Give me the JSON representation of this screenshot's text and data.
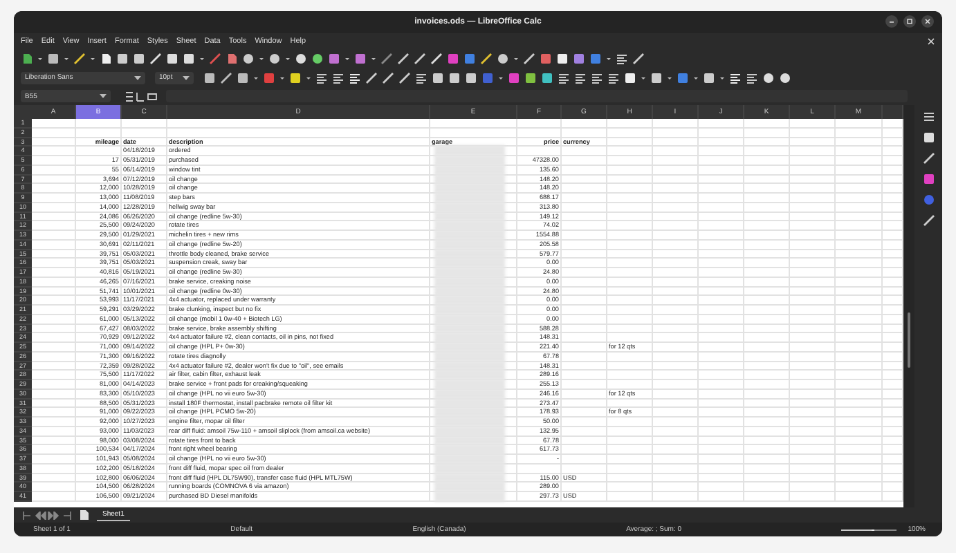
{
  "window": {
    "title": "invoices.ods — LibreOffice Calc"
  },
  "menu": [
    "File",
    "Edit",
    "View",
    "Insert",
    "Format",
    "Styles",
    "Sheet",
    "Data",
    "Tools",
    "Window",
    "Help"
  ],
  "toolbar": {
    "font_name": "Liberation Sans",
    "font_size": "10pt"
  },
  "formula_bar": {
    "name_box": "B55"
  },
  "columns": [
    {
      "label": "A",
      "selected": false
    },
    {
      "label": "B",
      "selected": true
    },
    {
      "label": "C",
      "selected": false
    },
    {
      "label": "D",
      "selected": false
    },
    {
      "label": "E",
      "selected": false
    },
    {
      "label": "F",
      "selected": false
    },
    {
      "label": "G",
      "selected": false
    },
    {
      "label": "H",
      "selected": false
    },
    {
      "label": "I",
      "selected": false
    },
    {
      "label": "J",
      "selected": false
    },
    {
      "label": "K",
      "selected": false
    },
    {
      "label": "L",
      "selected": false
    },
    {
      "label": "M",
      "selected": false
    }
  ],
  "rows": [
    {
      "number": "1"
    },
    {
      "number": "2"
    },
    {
      "number": "3",
      "kind": "header",
      "mileage": "mileage",
      "date": "date",
      "description": "description",
      "garage": "garage",
      "price": "price",
      "currency": "currency"
    },
    {
      "number": "4",
      "redacted": true,
      "date": "04/18/2019",
      "description": "ordered"
    },
    {
      "number": "5",
      "redacted": true,
      "mileage": "17",
      "date": "05/31/2019",
      "description": "purchased",
      "price": "47328.00"
    },
    {
      "number": "6",
      "redacted": true,
      "mileage": "55",
      "date": "06/14/2019",
      "description": "window tint",
      "price": "135.60"
    },
    {
      "number": "7",
      "redacted": true,
      "mileage": "3,694",
      "date": "07/12/2019",
      "description": "oil change",
      "price": "148.20"
    },
    {
      "number": "8",
      "redacted": true,
      "mileage": "12,000",
      "date": "10/28/2019",
      "description": "oil change",
      "price": "148.20"
    },
    {
      "number": "9",
      "redacted": true,
      "mileage": "13,000",
      "date": "11/08/2019",
      "description": "step bars",
      "price": "688.17"
    },
    {
      "number": "10",
      "redacted": true,
      "mileage": "14,000",
      "date": "12/28/2019",
      "description": "hellwig sway bar",
      "price": "313.80"
    },
    {
      "number": "11",
      "redacted": true,
      "mileage": "24,086",
      "date": "06/26/2020",
      "description": "oil change (redline 5w-30)",
      "price": "149.12"
    },
    {
      "number": "12",
      "redacted": true,
      "mileage": "25,500",
      "date": "09/24/2020",
      "description": "rotate tires",
      "price": "74.02"
    },
    {
      "number": "13",
      "redacted": true,
      "mileage": "29,500",
      "date": "01/29/2021",
      "description": "michelin tires + new rims",
      "price": "1554.88"
    },
    {
      "number": "14",
      "redacted": true,
      "mileage": "30,691",
      "date": "02/11/2021",
      "description": "oil change (redline 5w-20)",
      "price": "205.58"
    },
    {
      "number": "15",
      "redacted": true,
      "mileage": "39,751",
      "date": "05/03/2021",
      "description": "throttle body cleaned, brake service",
      "price": "579.77"
    },
    {
      "number": "16",
      "redacted": true,
      "mileage": "39,751",
      "date": "05/03/2021",
      "description": "suspension creak, sway bar",
      "price": "0.00"
    },
    {
      "number": "17",
      "redacted": true,
      "mileage": "40,816",
      "date": "05/19/2021",
      "description": "oil change (redline 5w-30)",
      "price": "24.80"
    },
    {
      "number": "18",
      "redacted": true,
      "mileage": "46,265",
      "date": "07/16/2021",
      "description": "brake service, creaking noise",
      "price": "0.00"
    },
    {
      "number": "19",
      "redacted": true,
      "mileage": "51,741",
      "date": "10/01/2021",
      "description": "oil change (redline 0w-30)",
      "price": "24.80"
    },
    {
      "number": "20",
      "redacted": true,
      "mileage": "53,993",
      "date": "11/17/2021",
      "description": "4x4 actuator, replaced under warranty",
      "price": "0.00"
    },
    {
      "number": "21",
      "redacted": true,
      "mileage": "59,291",
      "date": "03/29/2022",
      "description": "brake clunking, inspect but no fix",
      "price": "0.00"
    },
    {
      "number": "22",
      "redacted": true,
      "mileage": "61,000",
      "date": "05/13/2022",
      "description": "oil change (mobil 1 0w-40 + Biotech LG)",
      "price": "0.00"
    },
    {
      "number": "23",
      "redacted": true,
      "mileage": "67,427",
      "date": "08/03/2022",
      "description": "brake service, brake assembly shifting",
      "price": "588.28"
    },
    {
      "number": "24",
      "redacted": true,
      "mileage": "70,929",
      "date": "09/12/2022",
      "description": "4x4 actuator failure #2, clean contacts, oil in pins, not fixed",
      "price": "148.31"
    },
    {
      "number": "25",
      "redacted": true,
      "mileage": "71,000",
      "date": "09/14/2022",
      "description": "oil change (HPL P+ 0w-30)",
      "price": "221.40",
      "note": "for 12 qts"
    },
    {
      "number": "26",
      "redacted": true,
      "mileage": "71,300",
      "date": "09/16/2022",
      "description": "rotate tires diagnolly",
      "price": "67.78"
    },
    {
      "number": "27",
      "redacted": true,
      "mileage": "72,359",
      "date": "09/28/2022",
      "description": "4x4 actuator failure #2, dealer won't fix due to \"oil\", see emails",
      "price": "148.31"
    },
    {
      "number": "28",
      "redacted": true,
      "mileage": "75,500",
      "date": "11/17/2022",
      "description": "air filter, cabin filter, exhaust leak",
      "price": "289.16"
    },
    {
      "number": "29",
      "redacted": true,
      "mileage": "81,000",
      "date": "04/14/2023",
      "description": "brake service + front pads for creaking/squeaking",
      "price": "255.13"
    },
    {
      "number": "30",
      "redacted": true,
      "mileage": "83,300",
      "date": "05/10/2023",
      "description": "oil change (HPL no vii euro 5w-30)",
      "price": "246.16",
      "note": "for 12 qts"
    },
    {
      "number": "31",
      "redacted": true,
      "mileage": "88,500",
      "date": "05/31/2023",
      "description": "install 180F thermostat, install pacbrake remote oil filter kit",
      "price": "273.47"
    },
    {
      "number": "32",
      "redacted": true,
      "mileage": "91,000",
      "date": "09/22/2023",
      "description": "oil change (HPL PCMO 5w-20)",
      "price": "178.93",
      "note": "for 8 qts"
    },
    {
      "number": "33",
      "redacted": true,
      "mileage": "92,000",
      "date": "10/27/2023",
      "description": "engine filter, mopar oil filter",
      "price": "50.00"
    },
    {
      "number": "34",
      "redacted": true,
      "mileage": "93,000",
      "date": "11/03/2023",
      "description": "rear diff fluid: amsoil 75w-110 + amsoil sliplock (from amsoil.ca website)",
      "price": "132.95"
    },
    {
      "number": "35",
      "redacted": true,
      "mileage": "98,000",
      "date": "03/08/2024",
      "description": "rotate tires front to back",
      "price": "67.78"
    },
    {
      "number": "36",
      "redacted": true,
      "mileage": "100,534",
      "date": "04/17/2024",
      "description": "front right wheel bearing",
      "price": "617.73"
    },
    {
      "number": "37",
      "redacted": true,
      "mileage": "101,943",
      "date": "05/08/2024",
      "description": "oil change (HPL no vii euro 5w-30)",
      "price": "-"
    },
    {
      "number": "38",
      "redacted": true,
      "mileage": "102,200",
      "date": "05/18/2024",
      "description": "front diff fluid, mopar spec oil from dealer"
    },
    {
      "number": "39",
      "redacted": true,
      "mileage": "102,800",
      "date": "06/06/2024",
      "description": "front diff fluid (HPL DL75W90), transfer case fluid (HPL MTL75W)",
      "price": "115.00",
      "currency": "USD"
    },
    {
      "number": "40",
      "redacted": true,
      "mileage": "104,500",
      "date": "06/28/2024",
      "description": "running boards (COMNOVA 6 via amazon)",
      "price": "289.00"
    },
    {
      "number": "41",
      "redacted": true,
      "mileage": "106,500",
      "date": "09/21/2024",
      "description": "purchased BD Diesel manifolds",
      "price": "297.73",
      "currency": "USD"
    }
  ],
  "sheet_tabs": [
    {
      "label": "Sheet1",
      "selected": true
    }
  ],
  "status_bar": {
    "sheet": "Sheet 1 of 1",
    "page_style": "Default",
    "language": "English (Canada)",
    "summary": "Average: ; Sum: 0",
    "zoom": {
      "level": 0.55,
      "reading": "100%"
    }
  }
}
